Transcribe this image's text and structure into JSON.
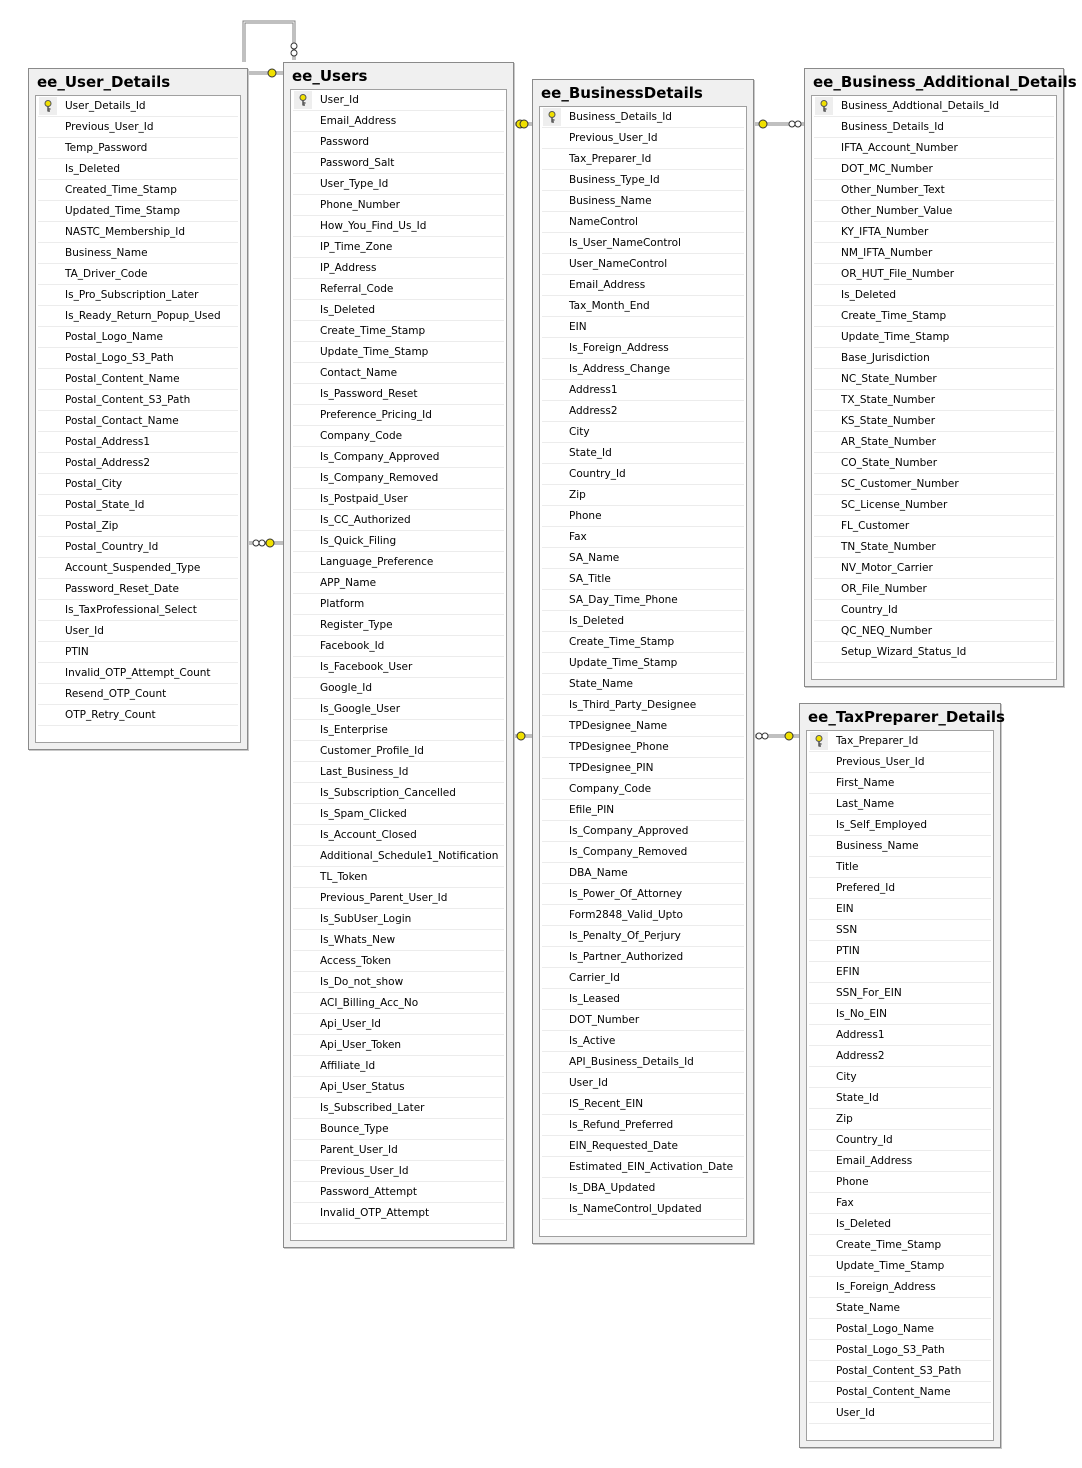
{
  "colors": {
    "key": "#f0e000",
    "border": "#8a8a8a",
    "line": "#808080"
  },
  "tables": [
    {
      "id": "ee_User_Details",
      "title": "ee_User_Details",
      "primary_key": "User_Details_Id",
      "columns": [
        "User_Details_Id",
        "Previous_User_Id",
        "Temp_Password",
        "Is_Deleted",
        "Created_Time_Stamp",
        "Updated_Time_Stamp",
        "NASTC_Membership_Id",
        "Business_Name",
        "TA_Driver_Code",
        "Is_Pro_Subscription_Later",
        "Is_Ready_Return_Popup_Used",
        "Postal_Logo_Name",
        "Postal_Logo_S3_Path",
        "Postal_Content_Name",
        "Postal_Content_S3_Path",
        "Postal_Contact_Name",
        "Postal_Address1",
        "Postal_Address2",
        "Postal_City",
        "Postal_State_Id",
        "Postal_Zip",
        "Postal_Country_Id",
        "Account_Suspended_Type",
        "Password_Reset_Date",
        "Is_TaxProfessional_Select",
        "User_Id",
        "PTIN",
        "Invalid_OTP_Attempt_Count",
        "Resend_OTP_Count",
        "OTP_Retry_Count"
      ]
    },
    {
      "id": "ee_Users",
      "title": "ee_Users",
      "primary_key": "User_Id",
      "columns": [
        "User_Id",
        "Email_Address",
        "Password",
        "Password_Salt",
        "User_Type_Id",
        "Phone_Number",
        "How_You_Find_Us_Id",
        "IP_Time_Zone",
        "IP_Address",
        "Referral_Code",
        "Is_Deleted",
        "Create_Time_Stamp",
        "Update_Time_Stamp",
        "Contact_Name",
        "Is_Password_Reset",
        "Preference_Pricing_Id",
        "Company_Code",
        "Is_Company_Approved",
        "Is_Company_Removed",
        "Is_Postpaid_User",
        "Is_CC_Authorized",
        "Is_Quick_Filing",
        "Language_Preference",
        "APP_Name",
        "Platform",
        "Register_Type",
        "Facebook_Id",
        "Is_Facebook_User",
        "Google_Id",
        "Is_Google_User",
        "Is_Enterprise",
        "Customer_Profile_Id",
        "Last_Business_Id",
        "Is_Subscription_Cancelled",
        "Is_Spam_Clicked",
        "Is_Account_Closed",
        "Additional_Schedule1_Notification",
        "TL_Token",
        "Previous_Parent_User_Id",
        "Is_SubUser_Login",
        "Is_Whats_New",
        "Access_Token",
        "Is_Do_not_show",
        "ACI_Billing_Acc_No",
        "Api_User_Id",
        "Api_User_Token",
        "Affiliate_Id",
        "Api_User_Status",
        "Is_Subscribed_Later",
        "Bounce_Type",
        "Parent_User_Id",
        "Previous_User_Id",
        "Password_Attempt",
        "Invalid_OTP_Attempt"
      ]
    },
    {
      "id": "ee_BusinessDetails",
      "title": "ee_BusinessDetails",
      "primary_key": "Business_Details_Id",
      "columns": [
        "Business_Details_Id",
        "Previous_User_Id",
        "Tax_Preparer_Id",
        "Business_Type_Id",
        "Business_Name",
        "NameControl",
        "Is_User_NameControl",
        "User_NameControl",
        "Email_Address",
        "Tax_Month_End",
        "EIN",
        "Is_Foreign_Address",
        "Is_Address_Change",
        "Address1",
        "Address2",
        "City",
        "State_Id",
        "Country_Id",
        "Zip",
        "Phone",
        "Fax",
        "SA_Name",
        "SA_Title",
        "SA_Day_Time_Phone",
        "Is_Deleted",
        "Create_Time_Stamp",
        "Update_Time_Stamp",
        "State_Name",
        "Is_Third_Party_Designee",
        "TPDesignee_Name",
        "TPDesignee_Phone",
        "TPDesignee_PIN",
        "Company_Code",
        "Efile_PIN",
        "Is_Company_Approved",
        "Is_Company_Removed",
        "DBA_Name",
        "Is_Power_Of_Attorney",
        "Form2848_Valid_Upto",
        "Is_Penalty_Of_Perjury",
        "Is_Partner_Authorized",
        "Carrier_Id",
        "Is_Leased",
        "DOT_Number",
        "Is_Active",
        "API_Business_Details_Id",
        "User_Id",
        "IS_Recent_EIN",
        "Is_Refund_Preferred",
        "EIN_Requested_Date",
        "Estimated_EIN_Activation_Date",
        "Is_DBA_Updated",
        "Is_NameControl_Updated"
      ]
    },
    {
      "id": "ee_Business_Additional_Details",
      "title": "ee_Business_Additional_Details",
      "primary_key": "Business_Addtional_Details_Id",
      "columns": [
        "Business_Addtional_Details_Id",
        "Business_Details_Id",
        "IFTA_Account_Number",
        "DOT_MC_Number",
        "Other_Number_Text",
        "Other_Number_Value",
        "KY_IFTA_Number",
        "NM_IFTA_Number",
        "OR_HUT_File_Number",
        "Is_Deleted",
        "Create_Time_Stamp",
        "Update_Time_Stamp",
        "Base_Jurisdiction",
        "NC_State_Number",
        "TX_State_Number",
        "KS_State_Number",
        "AR_State_Number",
        "CO_State_Number",
        "SC_Customer_Number",
        "SC_License_Number",
        "FL_Customer",
        "TN_State_Number",
        "NV_Motor_Carrier",
        "OR_File_Number",
        "Country_Id",
        "QC_NEQ_Number",
        "Setup_Wizard_Status_Id"
      ]
    },
    {
      "id": "ee_TaxPreparer_Details",
      "title": "ee_TaxPreparer_Details",
      "primary_key": "Tax_Preparer_Id",
      "columns": [
        "Tax_Preparer_Id",
        "Previous_User_Id",
        "First_Name",
        "Last_Name",
        "Is_Self_Employed",
        "Business_Name",
        "Title",
        "Prefered_Id",
        "EIN",
        "SSN",
        "PTIN",
        "EFIN",
        "SSN_For_EIN",
        "Is_No_EIN",
        "Address1",
        "Address2",
        "City",
        "State_Id",
        "Zip",
        "Country_Id",
        "Email_Address",
        "Phone",
        "Fax",
        "Is_Deleted",
        "Create_Time_Stamp",
        "Update_Time_Stamp",
        "Is_Foreign_Address",
        "State_Name",
        "Postal_Logo_Name",
        "Postal_Logo_S3_Path",
        "Postal_Content_S3_Path",
        "Postal_Content_Name",
        "User_Id"
      ]
    }
  ],
  "relationships": [
    {
      "from": "ee_Users",
      "to": "ee_Users",
      "type": "self-reference"
    },
    {
      "from": "ee_Users",
      "to": "ee_User_Details",
      "type": "one-to-many"
    },
    {
      "from": "ee_Users",
      "to": "ee_User_Details",
      "type": "one-to-many"
    },
    {
      "from": "ee_BusinessDetails",
      "to": "ee_Users",
      "type": "one-to-one"
    },
    {
      "from": "ee_Users",
      "to": "ee_BusinessDetails",
      "type": "one-to-many"
    },
    {
      "from": "ee_BusinessDetails",
      "to": "ee_Business_Additional_Details",
      "type": "one-to-many"
    },
    {
      "from": "ee_TaxPreparer_Details",
      "to": "ee_BusinessDetails",
      "type": "one-to-many"
    }
  ]
}
